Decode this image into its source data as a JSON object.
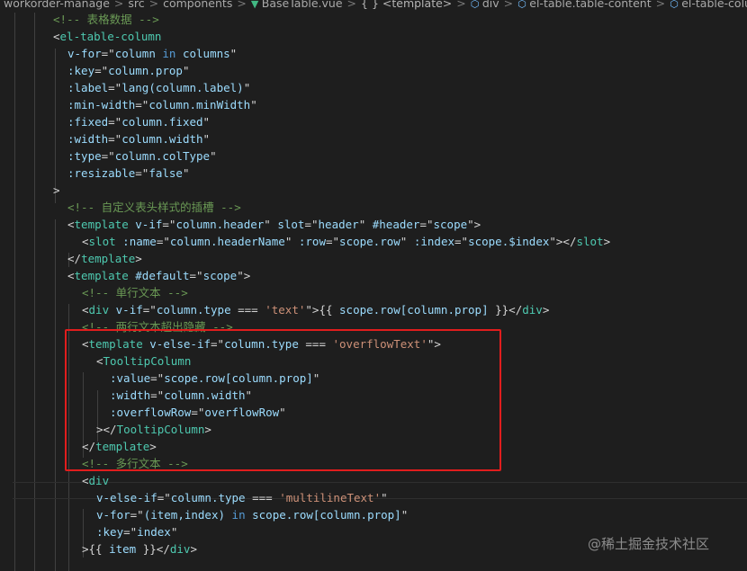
{
  "breadcrumb": {
    "items": [
      "workorder-manage",
      "src",
      "components",
      "BaseTable.vue",
      "{ } <template>",
      "div",
      "el-table.table-content",
      "el-table-column"
    ]
  },
  "colors": {
    "background": "#1e1e1e",
    "comment": "#6a9955",
    "tag": "#4ec9b0",
    "attr": "#9cdcfe",
    "string": "#ce9178",
    "text": "#d4d4d4",
    "keyword": "#569cd6",
    "highlight": "#e11d1d"
  },
  "code": {
    "lines": [
      [
        [
          "c",
          "<!-- 表格数据 -->"
        ]
      ],
      [
        [
          "p",
          "<"
        ],
        [
          "t",
          "el-table-column"
        ]
      ],
      [
        [
          "a",
          "v-for"
        ],
        [
          "p",
          "=\""
        ],
        [
          "s",
          "column "
        ],
        [
          "k",
          "in"
        ],
        [
          "s",
          " columns"
        ],
        [
          "p",
          "\""
        ]
      ],
      [
        [
          "a",
          ":key"
        ],
        [
          "p",
          "=\""
        ],
        [
          "s",
          "column.prop"
        ],
        [
          "p",
          "\""
        ]
      ],
      [
        [
          "a",
          ":label"
        ],
        [
          "p",
          "=\""
        ],
        [
          "s",
          "lang(column.label)"
        ],
        [
          "p",
          "\""
        ]
      ],
      [
        [
          "a",
          ":min-width"
        ],
        [
          "p",
          "=\""
        ],
        [
          "s",
          "column.minWidth"
        ],
        [
          "p",
          "\""
        ]
      ],
      [
        [
          "a",
          ":fixed"
        ],
        [
          "p",
          "=\""
        ],
        [
          "s",
          "column.fixed"
        ],
        [
          "p",
          "\""
        ]
      ],
      [
        [
          "a",
          ":width"
        ],
        [
          "p",
          "=\""
        ],
        [
          "s",
          "column.width"
        ],
        [
          "p",
          "\""
        ]
      ],
      [
        [
          "a",
          ":type"
        ],
        [
          "p",
          "=\""
        ],
        [
          "s",
          "column.colType"
        ],
        [
          "p",
          "\""
        ]
      ],
      [
        [
          "a",
          ":resizable"
        ],
        [
          "p",
          "=\""
        ],
        [
          "s",
          "false"
        ],
        [
          "p",
          "\""
        ]
      ],
      [
        [
          "p",
          ">"
        ]
      ],
      [
        [
          "c",
          "<!-- 自定义表头样式的插槽 -->"
        ]
      ],
      [
        [
          "p",
          "<"
        ],
        [
          "t",
          "template"
        ],
        [
          "p",
          " "
        ],
        [
          "a",
          "v-if"
        ],
        [
          "p",
          "=\""
        ],
        [
          "s",
          "column.header"
        ],
        [
          "p",
          "\" "
        ],
        [
          "a",
          "slot"
        ],
        [
          "p",
          "=\""
        ],
        [
          "s",
          "header"
        ],
        [
          "p",
          "\" "
        ],
        [
          "a",
          "#header"
        ],
        [
          "p",
          "=\""
        ],
        [
          "s",
          "scope"
        ],
        [
          "p",
          "\">"
        ]
      ],
      [
        [
          "p",
          "<"
        ],
        [
          "t",
          "slot"
        ],
        [
          "p",
          " "
        ],
        [
          "a",
          ":name"
        ],
        [
          "p",
          "=\""
        ],
        [
          "s",
          "column.headerName"
        ],
        [
          "p",
          "\" "
        ],
        [
          "a",
          ":row"
        ],
        [
          "p",
          "=\""
        ],
        [
          "s",
          "scope.row"
        ],
        [
          "p",
          "\" "
        ],
        [
          "a",
          ":index"
        ],
        [
          "p",
          "=\""
        ],
        [
          "s",
          "scope.$index"
        ],
        [
          "p",
          "\"></"
        ],
        [
          "t",
          "slot"
        ],
        [
          "p",
          ">"
        ]
      ],
      [
        [
          "p",
          "</"
        ],
        [
          "t",
          "template"
        ],
        [
          "p",
          ">"
        ]
      ],
      [
        [
          "p",
          "<"
        ],
        [
          "t",
          "template"
        ],
        [
          "p",
          " "
        ],
        [
          "a",
          "#default"
        ],
        [
          "p",
          "=\""
        ],
        [
          "s",
          "scope"
        ],
        [
          "p",
          "\">"
        ]
      ],
      [
        [
          "c",
          "<!-- 单行文本 -->"
        ]
      ],
      [
        [
          "p",
          "<"
        ],
        [
          "t",
          "div"
        ],
        [
          "p",
          " "
        ],
        [
          "a",
          "v-if"
        ],
        [
          "p",
          "=\""
        ],
        [
          "s",
          "column.type "
        ],
        [
          "p",
          "=== "
        ],
        [
          "r",
          "'text'"
        ],
        [
          "p",
          "\">{{ "
        ],
        [
          "s",
          "scope.row[column.prop]"
        ],
        [
          "p",
          " }}</"
        ],
        [
          "t",
          "div"
        ],
        [
          "p",
          ">"
        ]
      ],
      [
        [
          "c",
          "<!-- 两行文本超出隐藏 -->"
        ]
      ],
      [
        [
          "p",
          "<"
        ],
        [
          "t",
          "template"
        ],
        [
          "p",
          " "
        ],
        [
          "a",
          "v-else-if"
        ],
        [
          "p",
          "=\""
        ],
        [
          "s",
          "column.type "
        ],
        [
          "p",
          "=== "
        ],
        [
          "r",
          "'overflowText'"
        ],
        [
          "p",
          "\">"
        ]
      ],
      [
        [
          "p",
          "<"
        ],
        [
          "t",
          "TooltipColumn"
        ]
      ],
      [
        [
          "a",
          ":value"
        ],
        [
          "p",
          "=\""
        ],
        [
          "s",
          "scope.row[column.prop]"
        ],
        [
          "p",
          "\""
        ]
      ],
      [
        [
          "a",
          ":width"
        ],
        [
          "p",
          "=\""
        ],
        [
          "s",
          "column.width"
        ],
        [
          "p",
          "\""
        ]
      ],
      [
        [
          "a",
          ":overflowRow"
        ],
        [
          "p",
          "=\""
        ],
        [
          "s",
          "overflowRow"
        ],
        [
          "p",
          "\""
        ]
      ],
      [
        [
          "p",
          "></"
        ],
        [
          "t",
          "TooltipColumn"
        ],
        [
          "p",
          ">"
        ]
      ],
      [
        [
          "p",
          "</"
        ],
        [
          "t",
          "template"
        ],
        [
          "p",
          ">"
        ]
      ],
      [
        [
          "c",
          "<!-- 多行文本 -->"
        ]
      ],
      [
        [
          "p",
          "<"
        ],
        [
          "t",
          "div"
        ]
      ],
      [
        [
          "a",
          "v-else-if"
        ],
        [
          "p",
          "=\""
        ],
        [
          "s",
          "column.type "
        ],
        [
          "p",
          "=== "
        ],
        [
          "r",
          "'multilineText'"
        ],
        [
          "p",
          "\""
        ]
      ],
      [
        [
          "a",
          "v-for"
        ],
        [
          "p",
          "=\""
        ],
        [
          "s",
          "(item,index) "
        ],
        [
          "k",
          "in"
        ],
        [
          "s",
          " scope.row[column.prop]"
        ],
        [
          "p",
          "\""
        ]
      ],
      [
        [
          "a",
          ":key"
        ],
        [
          "p",
          "=\""
        ],
        [
          "s",
          "index"
        ],
        [
          "p",
          "\""
        ]
      ],
      [
        [
          "p",
          ">{{ "
        ],
        [
          "s",
          "item"
        ],
        [
          "p",
          " }}</"
        ],
        [
          "t",
          "div"
        ],
        [
          "p",
          ">"
        ]
      ]
    ]
  },
  "watermark": "@稀土掘金技术社区"
}
